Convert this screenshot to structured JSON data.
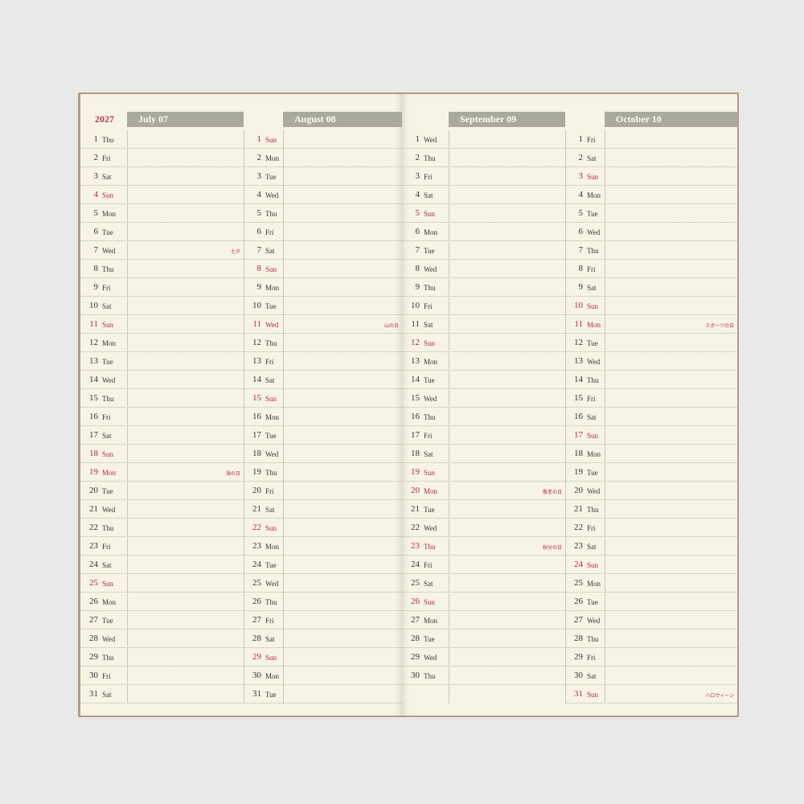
{
  "year": "2027",
  "months": [
    {
      "key": "jul",
      "label": "July 07",
      "days": [
        {
          "n": "1",
          "w": "Thu"
        },
        {
          "n": "2",
          "w": "Fri"
        },
        {
          "n": "3",
          "w": "Sat"
        },
        {
          "n": "4",
          "w": "Sun",
          "red": true
        },
        {
          "n": "5",
          "w": "Mon"
        },
        {
          "n": "6",
          "w": "Tue"
        },
        {
          "n": "7",
          "w": "Wed",
          "note": "七夕"
        },
        {
          "n": "8",
          "w": "Thu"
        },
        {
          "n": "9",
          "w": "Fri"
        },
        {
          "n": "10",
          "w": "Sat"
        },
        {
          "n": "11",
          "w": "Sun",
          "red": true
        },
        {
          "n": "12",
          "w": "Mon"
        },
        {
          "n": "13",
          "w": "Tue"
        },
        {
          "n": "14",
          "w": "Wed"
        },
        {
          "n": "15",
          "w": "Thu"
        },
        {
          "n": "16",
          "w": "Fri"
        },
        {
          "n": "17",
          "w": "Sat"
        },
        {
          "n": "18",
          "w": "Sun",
          "red": true
        },
        {
          "n": "19",
          "w": "Mon",
          "red": true,
          "note": "海の日"
        },
        {
          "n": "20",
          "w": "Tue"
        },
        {
          "n": "21",
          "w": "Wed"
        },
        {
          "n": "22",
          "w": "Thu"
        },
        {
          "n": "23",
          "w": "Fri"
        },
        {
          "n": "24",
          "w": "Sat"
        },
        {
          "n": "25",
          "w": "Sun",
          "red": true
        },
        {
          "n": "26",
          "w": "Mon"
        },
        {
          "n": "27",
          "w": "Tue"
        },
        {
          "n": "28",
          "w": "Wed"
        },
        {
          "n": "29",
          "w": "Thu"
        },
        {
          "n": "30",
          "w": "Fri"
        },
        {
          "n": "31",
          "w": "Sat"
        }
      ]
    },
    {
      "key": "aug",
      "label": "August 08",
      "days": [
        {
          "n": "1",
          "w": "Sun",
          "red": true
        },
        {
          "n": "2",
          "w": "Mon"
        },
        {
          "n": "3",
          "w": "Tue"
        },
        {
          "n": "4",
          "w": "Wed"
        },
        {
          "n": "5",
          "w": "Thu"
        },
        {
          "n": "6",
          "w": "Fri"
        },
        {
          "n": "7",
          "w": "Sat"
        },
        {
          "n": "8",
          "w": "Sun",
          "red": true
        },
        {
          "n": "9",
          "w": "Mon"
        },
        {
          "n": "10",
          "w": "Tue"
        },
        {
          "n": "11",
          "w": "Wed",
          "red": true,
          "note": "山の日"
        },
        {
          "n": "12",
          "w": "Thu"
        },
        {
          "n": "13",
          "w": "Fri"
        },
        {
          "n": "14",
          "w": "Sat"
        },
        {
          "n": "15",
          "w": "Sun",
          "red": true
        },
        {
          "n": "16",
          "w": "Mon"
        },
        {
          "n": "17",
          "w": "Tue"
        },
        {
          "n": "18",
          "w": "Wed"
        },
        {
          "n": "19",
          "w": "Thu"
        },
        {
          "n": "20",
          "w": "Fri"
        },
        {
          "n": "21",
          "w": "Sat"
        },
        {
          "n": "22",
          "w": "Sun",
          "red": true
        },
        {
          "n": "23",
          "w": "Mon"
        },
        {
          "n": "24",
          "w": "Tue"
        },
        {
          "n": "25",
          "w": "Wed"
        },
        {
          "n": "26",
          "w": "Thu"
        },
        {
          "n": "27",
          "w": "Fri"
        },
        {
          "n": "28",
          "w": "Sat"
        },
        {
          "n": "29",
          "w": "Sun",
          "red": true
        },
        {
          "n": "30",
          "w": "Mon"
        },
        {
          "n": "31",
          "w": "Tue"
        }
      ]
    },
    {
      "key": "sep",
      "label": "September 09",
      "days": [
        {
          "n": "1",
          "w": "Wed"
        },
        {
          "n": "2",
          "w": "Thu"
        },
        {
          "n": "3",
          "w": "Fri"
        },
        {
          "n": "4",
          "w": "Sat"
        },
        {
          "n": "5",
          "w": "Sun",
          "red": true
        },
        {
          "n": "6",
          "w": "Mon"
        },
        {
          "n": "7",
          "w": "Tue"
        },
        {
          "n": "8",
          "w": "Wed"
        },
        {
          "n": "9",
          "w": "Thu"
        },
        {
          "n": "10",
          "w": "Fri"
        },
        {
          "n": "11",
          "w": "Sat"
        },
        {
          "n": "12",
          "w": "Sun",
          "red": true
        },
        {
          "n": "13",
          "w": "Mon"
        },
        {
          "n": "14",
          "w": "Tue"
        },
        {
          "n": "15",
          "w": "Wed"
        },
        {
          "n": "16",
          "w": "Thu"
        },
        {
          "n": "17",
          "w": "Fri"
        },
        {
          "n": "18",
          "w": "Sat"
        },
        {
          "n": "19",
          "w": "Sun",
          "red": true
        },
        {
          "n": "20",
          "w": "Mon",
          "red": true,
          "note": "敬老の日"
        },
        {
          "n": "21",
          "w": "Tue"
        },
        {
          "n": "22",
          "w": "Wed"
        },
        {
          "n": "23",
          "w": "Thu",
          "red": true,
          "note": "秋分の日"
        },
        {
          "n": "24",
          "w": "Fri"
        },
        {
          "n": "25",
          "w": "Sat"
        },
        {
          "n": "26",
          "w": "Sun",
          "red": true
        },
        {
          "n": "27",
          "w": "Mon"
        },
        {
          "n": "28",
          "w": "Tue"
        },
        {
          "n": "29",
          "w": "Wed"
        },
        {
          "n": "30",
          "w": "Thu"
        }
      ]
    },
    {
      "key": "oct",
      "label": "October 10",
      "days": [
        {
          "n": "1",
          "w": "Fri"
        },
        {
          "n": "2",
          "w": "Sat"
        },
        {
          "n": "3",
          "w": "Sun",
          "red": true
        },
        {
          "n": "4",
          "w": "Mon"
        },
        {
          "n": "5",
          "w": "Tue"
        },
        {
          "n": "6",
          "w": "Wed"
        },
        {
          "n": "7",
          "w": "Thu"
        },
        {
          "n": "8",
          "w": "Fri"
        },
        {
          "n": "9",
          "w": "Sat"
        },
        {
          "n": "10",
          "w": "Sun",
          "red": true
        },
        {
          "n": "11",
          "w": "Mon",
          "red": true,
          "note": "スポーツの日"
        },
        {
          "n": "12",
          "w": "Tue"
        },
        {
          "n": "13",
          "w": "Wed"
        },
        {
          "n": "14",
          "w": "Thu"
        },
        {
          "n": "15",
          "w": "Fri"
        },
        {
          "n": "16",
          "w": "Sat"
        },
        {
          "n": "17",
          "w": "Sun",
          "red": true
        },
        {
          "n": "18",
          "w": "Mon"
        },
        {
          "n": "19",
          "w": "Tue"
        },
        {
          "n": "20",
          "w": "Wed"
        },
        {
          "n": "21",
          "w": "Thu"
        },
        {
          "n": "22",
          "w": "Fri"
        },
        {
          "n": "23",
          "w": "Sat"
        },
        {
          "n": "24",
          "w": "Sun",
          "red": true
        },
        {
          "n": "25",
          "w": "Mon"
        },
        {
          "n": "26",
          "w": "Tue"
        },
        {
          "n": "27",
          "w": "Wed"
        },
        {
          "n": "28",
          "w": "Thu"
        },
        {
          "n": "29",
          "w": "Fri"
        },
        {
          "n": "30",
          "w": "Sat"
        },
        {
          "n": "31",
          "w": "Sun",
          "red": true,
          "note": "ハロウィーン"
        }
      ]
    }
  ],
  "colors": {
    "header_bg": "#a9aa9c",
    "header_text": "#fbfbf6",
    "holiday_red": "#b0283c",
    "paper": "#f7f4e6"
  }
}
